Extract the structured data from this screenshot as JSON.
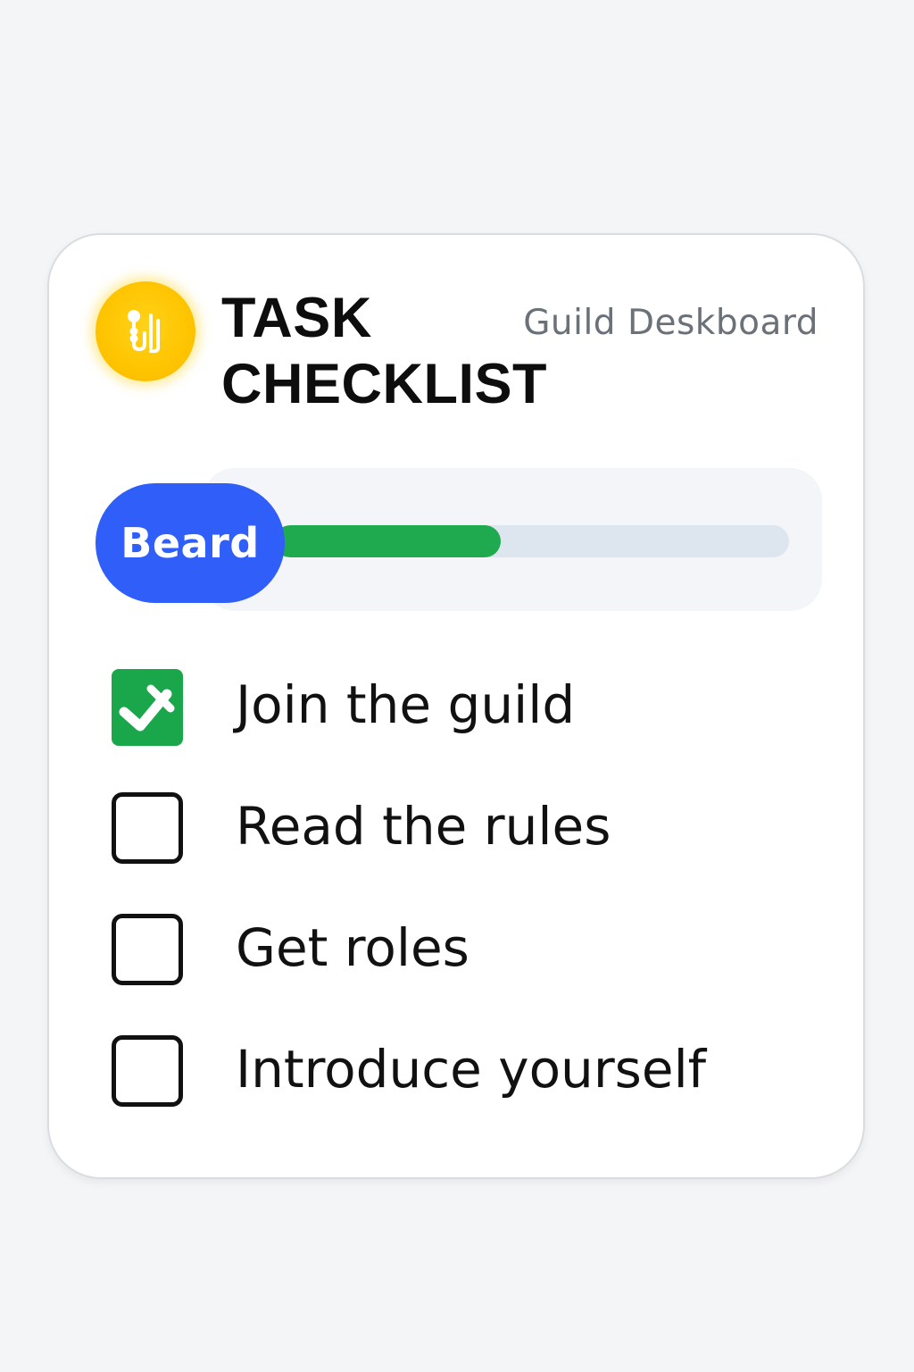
{
  "header": {
    "logo_icon": "yellow-circle-logo-icon",
    "title_line1": "TASK",
    "title_line2": "CHECKLIST",
    "subtitle": "Guild Deskboard"
  },
  "progress": {
    "label": "Beard",
    "fraction": 0.44,
    "fill_color": "#1faa4f",
    "track_color": "#dde6ef",
    "pill_color": "#2f5ef8"
  },
  "tasks": [
    {
      "label": "Join the guild",
      "checked": true
    },
    {
      "label": "Read the rules",
      "checked": false
    },
    {
      "label": "Get roles",
      "checked": false
    },
    {
      "label": "Introduce yourself",
      "checked": false
    }
  ]
}
